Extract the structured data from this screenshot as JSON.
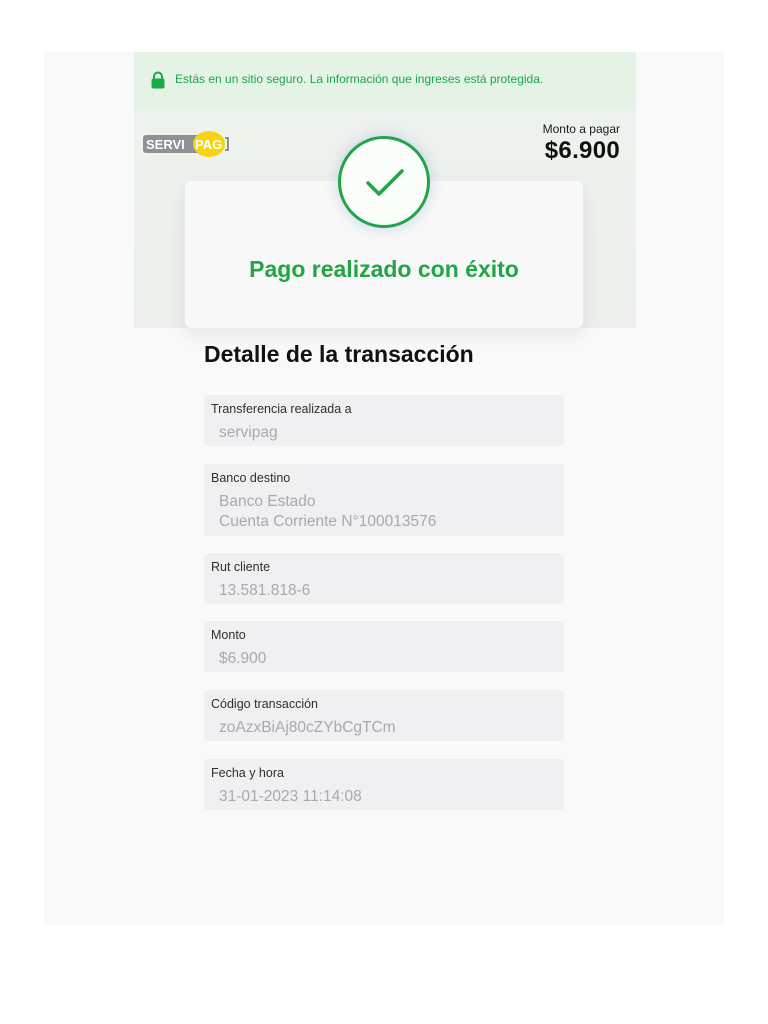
{
  "banner": {
    "secure_text": "Estás en un sitio seguro. La información que ingreses está protegida.",
    "icon": "lock-icon",
    "color": "#1aa84a"
  },
  "header": {
    "logo_text_left": "SERVI",
    "logo_text_right": "PAG",
    "amount_label": "Monto a pagar",
    "amount_value": "$6.900"
  },
  "success": {
    "message": "Pago realizado con éxito",
    "icon": "check-circle-icon",
    "color": "#22a447"
  },
  "details": {
    "title": "Detalle de la transacción",
    "fields": [
      {
        "label": "Transferencia realizada a",
        "value": "servipag"
      },
      {
        "label": "Banco destino",
        "value": "Banco Estado",
        "value2": "Cuenta Corriente N°100013576"
      },
      {
        "label": "Rut cliente",
        "value": "13.581.818-6"
      },
      {
        "label": "Monto",
        "value": "$6.900"
      },
      {
        "label": "Código transacción",
        "value": "zoAzxBiAj80cZYbCgTCm"
      },
      {
        "label": "Fecha y hora",
        "value": "31-01-2023 11:14:08"
      }
    ]
  }
}
